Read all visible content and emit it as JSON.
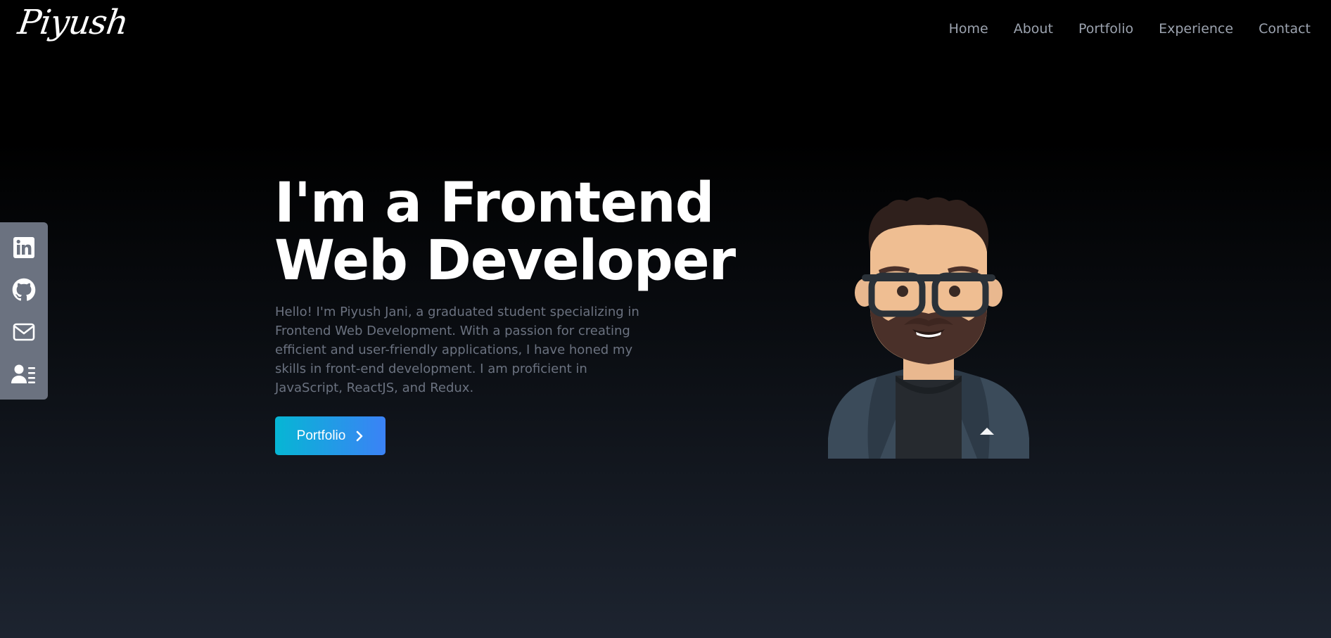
{
  "brand": {
    "logo_text": "Piyush"
  },
  "nav": {
    "items": [
      "Home",
      "About",
      "Portfolio",
      "Experience",
      "Contact"
    ]
  },
  "social": {
    "icons": [
      "linkedin-icon",
      "github-icon",
      "mail-icon",
      "resume-icon"
    ]
  },
  "hero": {
    "title_line1": "I'm a Frontend",
    "title_line2": "Web Developer",
    "description": "Hello! I'm Piyush Jani, a graduated student specializing in Frontend Web Development. With a passion for creating efficient and user-friendly applications, I have honed my skills in front-end development. I am proficient in JavaScript, ReactJS, and Redux.",
    "cta_label": "Portfolio"
  },
  "colors": {
    "nav_text": "#9ca3af",
    "sidebar_bg": "#6b7280",
    "cta_gradient_start": "#06b6d4",
    "cta_gradient_end": "#3b82f6"
  }
}
